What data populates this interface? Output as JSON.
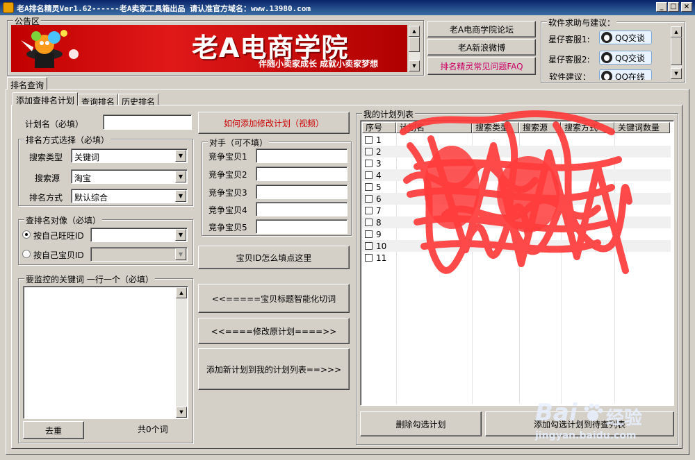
{
  "window": {
    "title": "老A排名精灵Ver1.62------老A卖家工具箱出品   请认准官方域名：www.13980.com",
    "min_label": "_",
    "max_label": "□",
    "close_label": "×"
  },
  "notice": {
    "group_title": "公告区",
    "banner_title": "老A电商学院",
    "banner_slogan": "伴随小卖家成长  成就小卖家梦想"
  },
  "links": {
    "forum": "老A电商学院论坛",
    "weibo": "老A新浪微博",
    "faq": "排名精灵常见问题FAQ"
  },
  "help": {
    "group_title": "软件求助与建议：",
    "support1_label": "星仔客服1:",
    "support2_label": "星仔客服2:",
    "suggest_label": "软件建议：",
    "qq_chat": "QQ交谈",
    "qq_online": "QQ在线"
  },
  "main_tab": "排名查询",
  "tabs": {
    "add": "添加查排名计划",
    "query": "查询排名",
    "history": "历史排名"
  },
  "form": {
    "plan_name_label": "计划名（必填）",
    "plan_name_value": "",
    "sort_group": "排名方式选择（必填）",
    "search_type_label": "搜索类型",
    "search_type_value": "关键词",
    "search_source_label": "搜索源",
    "search_source_value": "淘宝",
    "sort_method_label": "排名方式",
    "sort_method_value": "默认综合",
    "target_group": "查排名对像（必填）",
    "by_wangwang": "按自己旺旺ID",
    "by_item": "按自己宝贝ID",
    "keywords_group": "要监控的关键词 一行一个（必填）",
    "keywords_value": "",
    "dedupe_button": "去重",
    "word_count": "共0个词"
  },
  "middle": {
    "video_button": "如何添加修改计划（视频）",
    "rivals_group": "对手（可不填）",
    "rivals": [
      "竞争宝贝1",
      "竞争宝贝2",
      "竞争宝贝3",
      "竞争宝贝4",
      "竞争宝贝5"
    ],
    "item_id_help_button": "宝贝ID怎么填点这里",
    "split_title_button": "<<=====宝贝标题智能化切词",
    "modify_button": "<<====修改原计划====>>",
    "add_plan_button": "添加新计划到我的计划列表==>>>"
  },
  "plans": {
    "group_title": "我的计划列表",
    "columns": [
      "序号",
      "计划名",
      "搜索类型",
      "搜索源",
      "搜索方式",
      "关键词数量"
    ],
    "rows": [
      "1",
      "2",
      "3",
      "4",
      "5",
      "6",
      "7",
      "8",
      "9",
      "10",
      "11"
    ],
    "delete_button": "删除勾选计划",
    "add_query_button": "添加勾选计划到待查列表"
  },
  "watermark": {
    "brand": "Bai",
    "brand_cn": "经验",
    "site": "jingyan.baidu.com"
  },
  "colors": {
    "face": "#d4d0c8",
    "title_bar": "#0a246a",
    "faq_link": "#cc0066",
    "video_link": "#cc0000",
    "banner_red": "#d01010",
    "scribble": "#ff3b3b"
  }
}
